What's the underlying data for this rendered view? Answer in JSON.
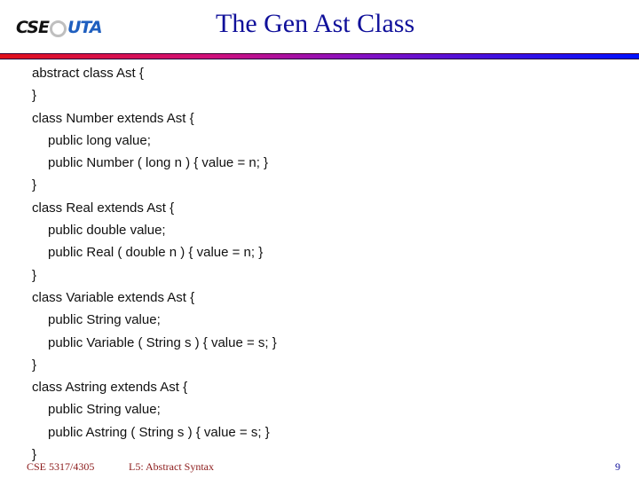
{
  "header": {
    "logo": {
      "left": "CSE",
      "right": "UTA"
    },
    "title": "The Gen Ast Class",
    "colors": {
      "title": "#10109a",
      "rule_start": "#e0101a",
      "rule_end": "#0010ff"
    }
  },
  "code_lines": [
    {
      "text": "abstract class Ast {",
      "indent": false
    },
    {
      "text": "}",
      "indent": false
    },
    {
      "text": "class Number extends Ast {",
      "indent": false
    },
    {
      "text": "public long value;",
      "indent": true
    },
    {
      "text": "public Number ( long n ) { value = n; }",
      "indent": true
    },
    {
      "text": "}",
      "indent": false
    },
    {
      "text": "class Real extends Ast {",
      "indent": false
    },
    {
      "text": "public double value;",
      "indent": true
    },
    {
      "text": "public Real ( double n ) { value = n; }",
      "indent": true
    },
    {
      "text": "}",
      "indent": false
    },
    {
      "text": "class Variable extends Ast {",
      "indent": false
    },
    {
      "text": "public String value;",
      "indent": true
    },
    {
      "text": "public Variable ( String s ) { value = s; }",
      "indent": true
    },
    {
      "text": "}",
      "indent": false
    },
    {
      "text": "class Astring extends Ast {",
      "indent": false
    },
    {
      "text": "public String value;",
      "indent": true
    },
    {
      "text": "public Astring ( String s ) { value = s; }",
      "indent": true
    },
    {
      "text": "}",
      "indent": false
    }
  ],
  "footer": {
    "course": "CSE 5317/4305",
    "lecture": "L5: Abstract Syntax",
    "page_number": "9",
    "colors": {
      "text": "#8b1a1a",
      "page": "#10109a"
    }
  }
}
